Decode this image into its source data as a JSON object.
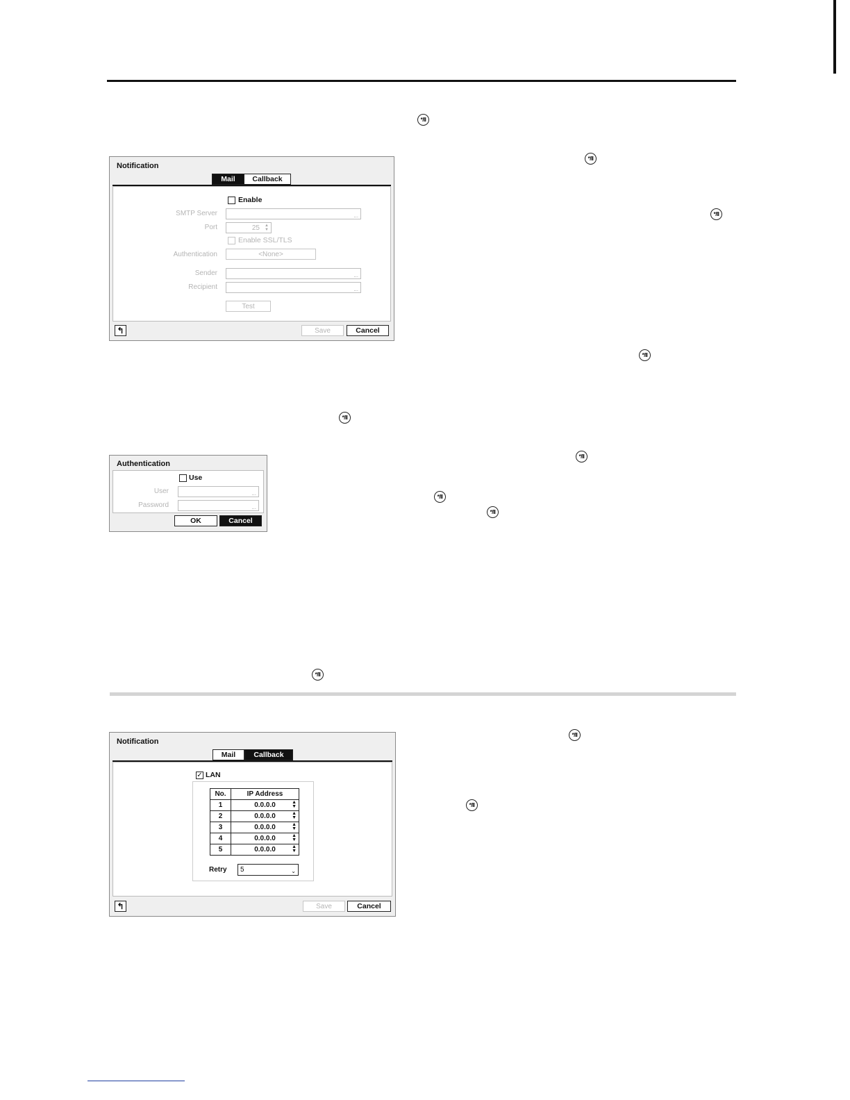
{
  "button_glyph": "*/II",
  "notification_mail": {
    "title": "Notification",
    "tabs": [
      {
        "label": "Mail",
        "active": true
      },
      {
        "label": "Callback",
        "active": false
      }
    ],
    "enable_label": "Enable",
    "enable_checked": false,
    "smtp_server_label": "SMTP Server",
    "smtp_server_value": "",
    "port_label": "Port",
    "port_value": "25",
    "ssl_label": "Enable SSL/TLS",
    "authentication_label": "Authentication",
    "authentication_value": "<None>",
    "sender_label": "Sender",
    "sender_value": "",
    "recipient_label": "Recipient",
    "recipient_value": "",
    "test_label": "Test",
    "save_label": "Save",
    "cancel_label": "Cancel"
  },
  "authentication_dialog": {
    "title": "Authentication",
    "use_label": "Use",
    "use_checked": false,
    "user_label": "User",
    "password_label": "Password",
    "ok_label": "OK",
    "cancel_label": "Cancel"
  },
  "notification_callback": {
    "title": "Notification",
    "tabs": [
      {
        "label": "Mail",
        "active": false
      },
      {
        "label": "Callback",
        "active": true
      }
    ],
    "lan_label": "LAN",
    "lan_checked": true,
    "table_headers": [
      "No.",
      "IP Address"
    ],
    "rows": [
      {
        "no": "1",
        "ip": "0.0.0.0"
      },
      {
        "no": "2",
        "ip": "0.0.0.0"
      },
      {
        "no": "3",
        "ip": "0.0.0.0"
      },
      {
        "no": "4",
        "ip": "0.0.0.0"
      },
      {
        "no": "5",
        "ip": "0.0.0.0"
      }
    ],
    "retry_label": "Retry",
    "retry_value": "5",
    "save_label": "Save",
    "cancel_label": "Cancel"
  }
}
